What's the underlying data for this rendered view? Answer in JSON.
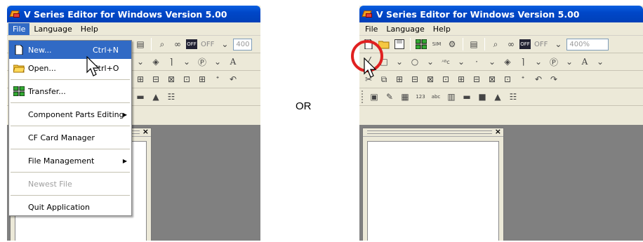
{
  "separator_text": "OR",
  "left": {
    "title": "V Series Editor for Windows Version 5.00",
    "menubar": [
      "File",
      "Language",
      "Help"
    ],
    "toolbar": {
      "off_label": "OFF",
      "zoom_text": "400"
    },
    "file_menu": [
      {
        "label": "New...",
        "shortcut": "Ctrl+N",
        "icon": "new-document-icon",
        "highlighted": true
      },
      {
        "label": "Open...",
        "shortcut": "Ctrl+O",
        "icon": "open-folder-icon"
      },
      {
        "label": "Transfer...",
        "icon": "transfer-icon"
      },
      {
        "label": "Component Parts Editing",
        "submenu": true
      },
      {
        "label": "CF Card Manager"
      },
      {
        "label": "File Management",
        "submenu": true
      },
      {
        "label": "Newest File",
        "disabled": true
      },
      {
        "label": "Quit Application"
      }
    ]
  },
  "right": {
    "title": "V Series Editor for Windows Version 5.00",
    "menubar": [
      "File",
      "Language",
      "Help"
    ],
    "toolbar": {
      "off_label": "OFF",
      "zoom_text": "400%"
    }
  },
  "colors": {
    "titlebar": "#0047c8",
    "highlight": "#316ac5",
    "circle": "#e02020"
  }
}
